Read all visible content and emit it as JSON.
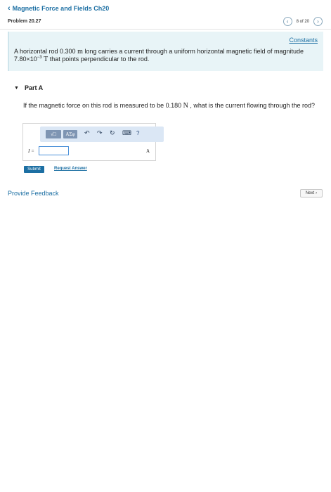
{
  "header": {
    "back_label": "Magnetic Force and Fields Ch20",
    "problem_label": "Problem 20.27",
    "pager_text": "8 of 20"
  },
  "info": {
    "constants_label": "Constants",
    "text_prefix": "A horizontal rod 0.300 ",
    "unit_m": "m",
    "text_mid": " long carries a current through a uniform horizontal magnetic field of magnitude 7.80×10",
    "exponent": "−3",
    "unit_T": "T",
    "text_suffix": " that points perpendicular to the rod."
  },
  "part": {
    "label": "Part A",
    "question_prefix": "If the magnetic force on this rod is measured to be 0.180 ",
    "unit_N": "N",
    "question_suffix": " , what is the current flowing through the rod?"
  },
  "answer": {
    "toolbar": {
      "template_label": "√□",
      "symbols_label": "ΑΣφ",
      "help_label": "?"
    },
    "variable_label": "I =",
    "value": "",
    "unit": "A"
  },
  "actions": {
    "submit_label": "Submit",
    "request_label": "Request Answer",
    "feedback_label": "Provide Feedback",
    "next_label": "Next"
  }
}
